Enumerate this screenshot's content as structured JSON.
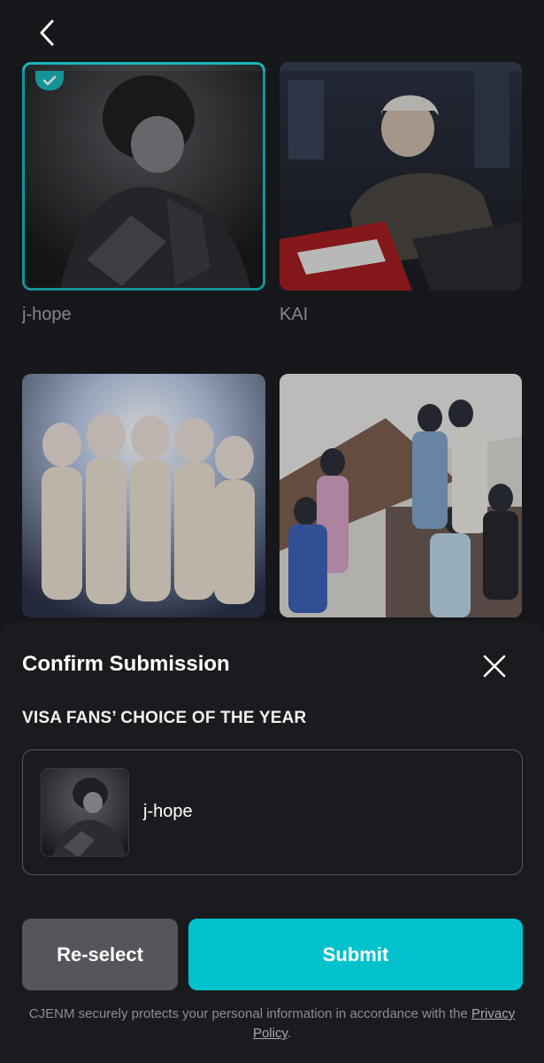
{
  "header": {
    "back_icon": "chevron-left-icon"
  },
  "grid": {
    "items": [
      {
        "label": "j-hope",
        "selected": true
      },
      {
        "label": "KAI",
        "selected": false
      },
      {
        "label": "",
        "selected": false
      },
      {
        "label": "",
        "selected": false
      }
    ]
  },
  "sheet": {
    "title": "Confirm Submission",
    "close_icon": "close-icon",
    "category": "VISA FANS’ CHOICE OF THE YEAR",
    "selected_name": "j-hope",
    "reselect_label": "Re-select",
    "submit_label": "Submit",
    "privacy_text": "CJENM securely protects your personal information in accordance with the",
    "privacy_link": "Privacy Policy",
    "privacy_end": "."
  },
  "colors": {
    "accent": "#00c2cc",
    "selected_border": "#1ab5b8",
    "background": "#1c1d21",
    "sheet": "#1a1b1e"
  }
}
